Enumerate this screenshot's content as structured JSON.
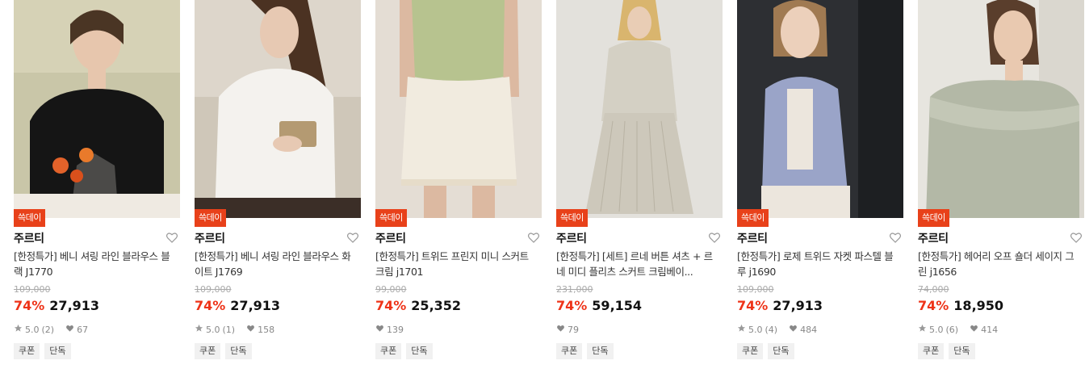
{
  "products": [
    {
      "badge": "쓱데이",
      "brand": "주르티",
      "name": "[한정특가] 베니 셔링 라인 블라우스 블랙 J1770",
      "original_price": "109,000",
      "discount": "74%",
      "price": "27,913",
      "rating": "5.0",
      "reviews": "(2)",
      "likes": "67",
      "tags": [
        "쿠폰",
        "단독"
      ]
    },
    {
      "badge": "쓱데이",
      "brand": "주르티",
      "name": "[한정특가] 베니 셔링 라인 블라우스 화이트 J1769",
      "original_price": "109,000",
      "discount": "74%",
      "price": "27,913",
      "rating": "5.0",
      "reviews": "(1)",
      "likes": "158",
      "tags": [
        "쿠폰",
        "단독"
      ]
    },
    {
      "badge": "쓱데이",
      "brand": "주르티",
      "name": "[한정특가] 트위드 프린지 미니 스커트 크림 j1701",
      "original_price": "99,000",
      "discount": "74%",
      "price": "25,352",
      "likes": "139",
      "tags": [
        "쿠폰",
        "단독"
      ]
    },
    {
      "badge": "쓱데이",
      "brand": "주르티",
      "name": "[한정특가] [세트] 르네 버튼 셔츠 + 르네 미디 플리츠 스커트 크림베이...",
      "original_price": "231,000",
      "discount": "74%",
      "price": "59,154",
      "likes": "79",
      "tags": [
        "쿠폰",
        "단독"
      ]
    },
    {
      "badge": "쓱데이",
      "brand": "주르티",
      "name": "[한정특가] 로제 트위드 자켓 파스텔 블루 j1690",
      "original_price": "109,000",
      "discount": "74%",
      "price": "27,913",
      "rating": "5.0",
      "reviews": "(4)",
      "likes": "484",
      "tags": [
        "쿠폰",
        "단독"
      ]
    },
    {
      "badge": "쓱데이",
      "brand": "주르티",
      "name": "[한정특가] 헤어리 오프 숄더 세이지 그린 j1656",
      "original_price": "74,000",
      "discount": "74%",
      "price": "18,950",
      "rating": "5.0",
      "reviews": "(6)",
      "likes": "414",
      "tags": [
        "쿠폰",
        "단독"
      ]
    }
  ],
  "icons": {
    "wishlist": "heart-outline-icon",
    "rating": "star-icon",
    "likes": "heart-filled-icon"
  },
  "colors": {
    "badge": "#e8411a",
    "discount": "#ee3318"
  }
}
